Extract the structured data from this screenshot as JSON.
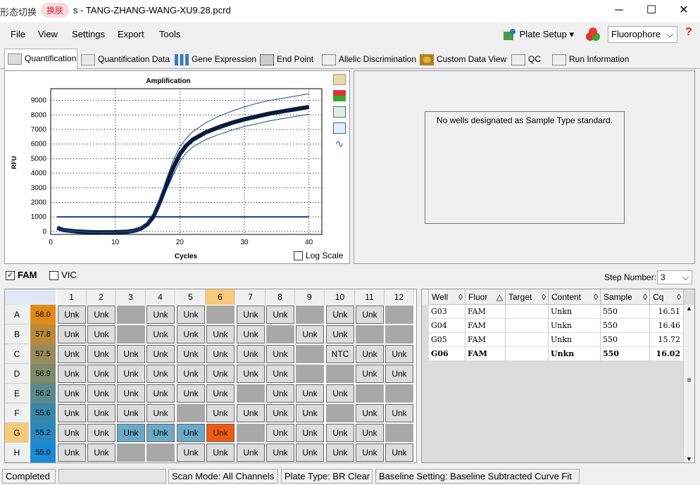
{
  "titlebar": {
    "cn_text": "形态切换",
    "badge": "换肤",
    "title": "s - TANG-ZHANG-WANG-XU9.28.pcrd",
    "min": "─",
    "max": "☐",
    "close": "✕"
  },
  "menu": [
    "File",
    "View",
    "Settings",
    "Export",
    "Tools"
  ],
  "toolbar": {
    "plate_setup": "Plate Setup",
    "fluorophore": "Fluorophore",
    "help": "?"
  },
  "tabs": [
    "Quantification",
    "Quantification Data",
    "Gene Expression",
    "End Point",
    "Allelic Discrimination",
    "Custom Data View",
    "QC",
    "Run Information"
  ],
  "chart_data": {
    "type": "line",
    "title": "Amplification",
    "xlabel": "Cycles",
    "ylabel": "RFU",
    "xlim": [
      0,
      42
    ],
    "ylim": [
      -200,
      9800
    ],
    "xticks": [
      0,
      10,
      20,
      30,
      40
    ],
    "yticks": [
      0,
      1000,
      2000,
      3000,
      4000,
      5000,
      6000,
      7000,
      8000,
      9000
    ],
    "threshold": 1000,
    "series": [
      {
        "x": [
          1,
          2,
          4,
          6,
          8,
          10,
          12,
          13,
          14,
          15,
          16,
          17,
          18,
          19,
          20,
          21,
          22,
          24,
          26,
          28,
          30,
          32,
          34,
          36,
          38,
          40
        ],
        "y": [
          250,
          100,
          0,
          -40,
          -60,
          -50,
          -10,
          60,
          200,
          500,
          1100,
          2100,
          3300,
          4400,
          5300,
          5900,
          6300,
          6800,
          7150,
          7450,
          7700,
          7900,
          8100,
          8250,
          8400,
          8550
        ]
      },
      {
        "x": [
          1,
          2,
          4,
          6,
          8,
          10,
          12,
          13,
          14,
          15,
          16,
          17,
          18,
          19,
          20,
          21,
          22,
          24,
          26,
          28,
          30,
          32,
          34,
          36,
          38,
          40
        ],
        "y": [
          300,
          150,
          30,
          -20,
          -40,
          -30,
          10,
          100,
          280,
          650,
          1300,
          2400,
          3700,
          4900,
          5800,
          6400,
          6850,
          7450,
          7900,
          8250,
          8550,
          8800,
          9000,
          9150,
          9300,
          9450
        ]
      },
      {
        "x": [
          1,
          2,
          4,
          6,
          8,
          10,
          12,
          13,
          14,
          15,
          16,
          17,
          18,
          19,
          20,
          21,
          22,
          24,
          26,
          28,
          30,
          32,
          34,
          36,
          38,
          40
        ],
        "y": [
          200,
          60,
          -20,
          -60,
          -80,
          -70,
          -30,
          20,
          120,
          350,
          850,
          1800,
          2900,
          3900,
          4800,
          5400,
          5800,
          6300,
          6650,
          6950,
          7200,
          7400,
          7600,
          7750,
          7900,
          8050
        ]
      }
    ],
    "log_scale": false,
    "log_scale_label": "Log Scale"
  },
  "std_message": "No wells designated as Sample Type standard.",
  "fluor": {
    "fam": "FAM",
    "vic": "VIC",
    "step_label": "Step Number:",
    "step_value": "3"
  },
  "plate": {
    "cols": [
      "1",
      "2",
      "3",
      "4",
      "5",
      "6",
      "7",
      "8",
      "9",
      "10",
      "11",
      "12"
    ],
    "rows": [
      {
        "r": "A",
        "t": "58.0",
        "c": "#e08a1a",
        "w": [
          "Unk",
          "Unk",
          "",
          "Unk",
          "Unk",
          "",
          "Unk",
          "Unk",
          "",
          "Unk",
          "Unk",
          ""
        ]
      },
      {
        "r": "B",
        "t": "57.8",
        "c": "#b88a3a",
        "w": [
          "Unk",
          "Unk",
          "",
          "Unk",
          "Unk",
          "Unk",
          "Unk",
          "",
          "Unk",
          "Unk",
          "",
          ""
        ]
      },
      {
        "r": "C",
        "t": "57.5",
        "c": "#9a8c5a",
        "w": [
          "Unk",
          "Unk",
          "Unk",
          "Unk",
          "Unk",
          "Unk",
          "Unk",
          "Unk",
          "",
          "NTC",
          "Unk",
          "Unk"
        ]
      },
      {
        "r": "D",
        "t": "56.9",
        "c": "#7e8a6a",
        "w": [
          "Unk",
          "Unk",
          "Unk",
          "Unk",
          "Unk",
          "Unk",
          "Unk",
          "Unk",
          "",
          "",
          "Unk",
          "Unk"
        ]
      },
      {
        "r": "E",
        "t": "56.2",
        "c": "#5a8a8a",
        "w": [
          "Unk",
          "Unk",
          "Unk",
          "Unk",
          "Unk",
          "Unk",
          "",
          "Unk",
          "Unk",
          "Unk",
          "",
          ""
        ]
      },
      {
        "r": "F",
        "t": "55.6",
        "c": "#3a86a8",
        "w": [
          "Unk",
          "Unk",
          "Unk",
          "Unk",
          "",
          "Unk",
          "Unk",
          "Unk",
          "Unk",
          "",
          "Unk",
          "Unk"
        ]
      },
      {
        "r": "G",
        "t": "55.2",
        "c": "#2a88c0",
        "w": [
          "Unk",
          "Unk",
          "Unk",
          "Unk",
          "Unk",
          "Unk",
          "",
          "Unk",
          "Unk",
          "Unk",
          "Unk",
          ""
        ]
      },
      {
        "r": "H",
        "t": "55.0",
        "c": "#1a8ad6",
        "w": [
          "Unk",
          "Unk",
          "",
          "",
          "Unk",
          "Unk",
          "Unk",
          "Unk",
          "Unk",
          "Unk",
          "Unk",
          "Unk"
        ]
      }
    ]
  },
  "table": {
    "headers": [
      "Well",
      "Fluor",
      "Target",
      "Content",
      "Sample",
      "Cq"
    ],
    "rows": [
      [
        "G03",
        "FAM",
        "",
        "Unkn",
        "550",
        "16.51"
      ],
      [
        "G04",
        "FAM",
        "",
        "Unkn",
        "550",
        "16.46"
      ],
      [
        "G05",
        "FAM",
        "",
        "Unkn",
        "550",
        "15.72"
      ],
      [
        "G06",
        "FAM",
        "",
        "Unkn",
        "550",
        "16.02"
      ]
    ]
  },
  "status": [
    "Completed",
    "",
    "Scan Mode: All Channels",
    "Plate Type: BR Clear",
    "Baseline Setting: Baseline Subtracted Curve Fit"
  ]
}
